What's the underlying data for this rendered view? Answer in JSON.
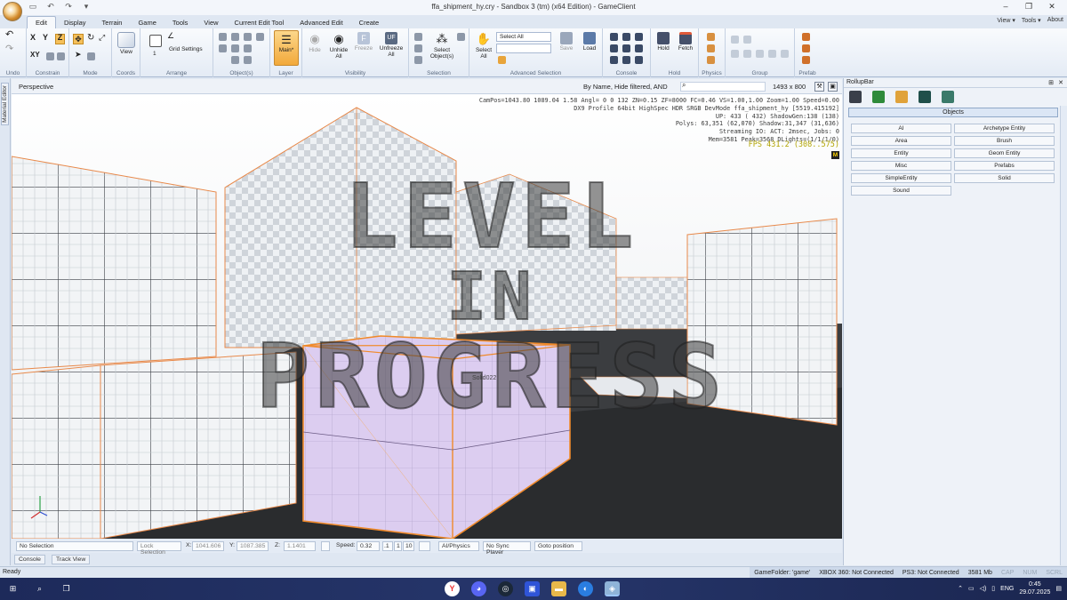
{
  "window": {
    "title": "ffa_shipment_hy.cry - Sandbox 3 (tm) (x64 Edition) - GameClient",
    "controls": [
      "–",
      "❐",
      "✕"
    ]
  },
  "ribbon_tabs": [
    "Edit",
    "Display",
    "Terrain",
    "Game",
    "Tools",
    "View",
    "Current Edit Tool",
    "Advanced Edit",
    "Create"
  ],
  "ribbon_right": {
    "view": "View ▾",
    "tools": "Tools ▾",
    "about": "About"
  },
  "ribbon_groups": {
    "undo": "Undo",
    "constrain": "Constrain",
    "mode": "Mode",
    "coords": "Coords",
    "arrange": "Arrange",
    "objects": "Object(s)",
    "layer": "Layer",
    "visibility": "Visibility",
    "selection": "Selection",
    "advanced_selection": "Advanced Selection",
    "console": "Console",
    "hold": "Hold",
    "physics": "Physics",
    "group": "Group",
    "prefab": "Prefab"
  },
  "ribbon_buttons": {
    "view": "View",
    "grid_settings": "Grid Settings",
    "arrange_value": "1",
    "main_layer": "Main*",
    "hide": "Hide",
    "unhide_all": "Unhide All",
    "freeze": "Freeze",
    "unfreeze_all": "Unfreeze All",
    "select_objects": "Select Object(s)",
    "select_all_btn": "Select All",
    "select_all_dropdown": "Select All",
    "save": "Save",
    "load": "Load",
    "hold": "Hold",
    "fetch": "Fetch"
  },
  "side_strip": {
    "label": "Material Editor"
  },
  "viewport": {
    "title": "Perspective",
    "filter": "By Name, Hide filtered, AND",
    "size": "1493 x 800",
    "stats": [
      "CamPos=1043.80 1089.04 1.58 Angl= 0 0 132 ZN=0.15 ZF=8000 FC=0.46 VS=1.00,1.00 Zoom=1.00 Speed=0.00",
      "DX9 Profile 64bit HighSpec HDR SRGB DevMode ffa_shipment_hy [5519.415192]",
      "UP: 433 ( 432) ShadowGen:138 (138)",
      "Polys: 63,351 (62,070) Shadow:31,347 (31,636)",
      "Streaming IO: ACT: 2msec, Jobs: 0",
      "Mem=3581 Peak=3568 DLights=(1/1/1/0)"
    ],
    "fps": "FPS 431.2 (308..575)",
    "m_badge": "M",
    "watermark": [
      "LEVEL",
      "IN",
      "PROGRESS"
    ],
    "object_label": "Solid022"
  },
  "bottom_bar": {
    "selection": "No Selection",
    "lock_selection": "Lock Selection",
    "x_label": "X:",
    "x_value": "1041.606",
    "y_label": "Y:",
    "y_value": "1087.385",
    "z_label": "Z:",
    "z_value": "1.1401",
    "speed_label": "Speed:",
    "speed_value": "0.32",
    "speed_presets": [
      ".1",
      "1",
      "10"
    ],
    "ai_physics": "AI/Physics",
    "no_sync_player": "No Sync Player",
    "goto_position": "Goto position"
  },
  "console_tabs": [
    "Console",
    "Track View"
  ],
  "rollup": {
    "title": "RollupBar",
    "pin": "⊞",
    "close": "✕",
    "section": "Objects",
    "buttons": [
      "AI",
      "Archetype Entity",
      "Area",
      "Brush",
      "Entity",
      "Geom Entity",
      "Misc",
      "Prefabs",
      "SimpleEntity",
      "Solid",
      "Sound"
    ]
  },
  "statusbar": {
    "ready": "Ready",
    "game_folder": "GameFolder: 'game'",
    "xbox": "XBOX 360: Not Connected",
    "ps3": "PS3: Not Connected",
    "mem": "3581 Mb",
    "cap": "CAP",
    "num": "NUM",
    "scrl": "SCRL"
  },
  "taskbar": {
    "lang": "ENG",
    "time": "0:45",
    "date": "29.07.2025"
  },
  "colors": {
    "accent_orange": "#f09a3a",
    "selection_lilac": "#d9c6f2",
    "fps_yellow": "#b1a400",
    "ribbon_blue": "#dfe7f2"
  }
}
